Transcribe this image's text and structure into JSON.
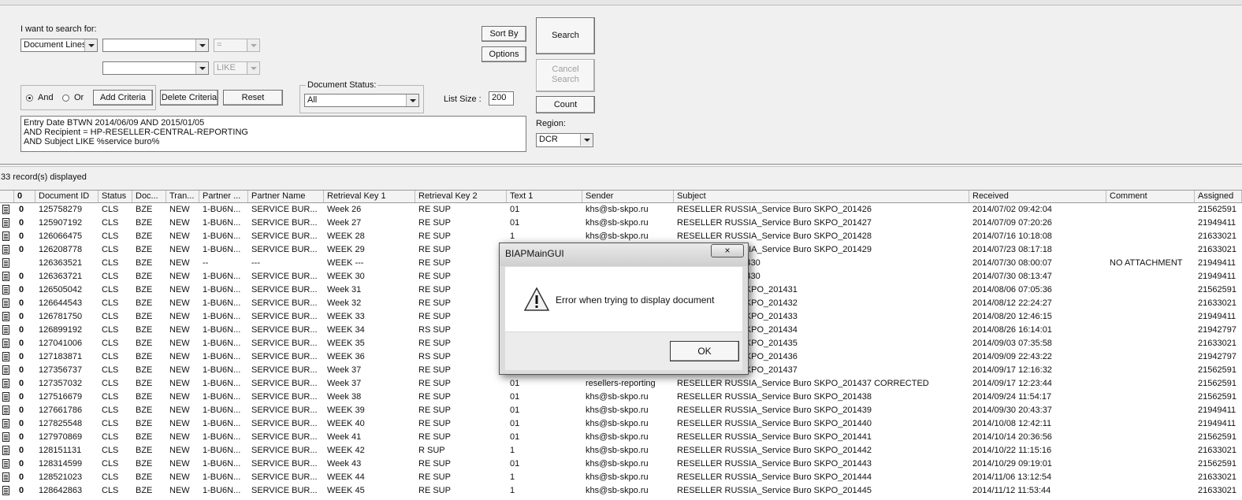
{
  "search": {
    "heading": "I want to search for:",
    "type_value": "Document Lines",
    "row1_field": "",
    "row1_op": "=",
    "row2_field": "",
    "row2_op": "LIKE",
    "and_label": "And",
    "or_label": "Or",
    "add_criteria": "Add Criteria",
    "delete_criteria": "Delete Criteria",
    "reset": "Reset",
    "doc_status_label": "Document Status:",
    "doc_status_value": "All",
    "list_size_label": "List Size :",
    "list_size_value": "200",
    "criteria_text": "Entry Date BTWN 2014/06/09 AND 2015/01/05\nAND Recipient = HP-RESELLER-CENTRAL-REPORTING\nAND Subject LIKE %service buro%",
    "sort_by": "Sort By",
    "options": "Options",
    "search_btn": "Search",
    "cancel_search": "Cancel\nSearch",
    "count": "Count",
    "region_label": "Region:",
    "region_value": "DCR"
  },
  "status": {
    "records": "33 record(s) displayed"
  },
  "grid": {
    "attachment_glyph": "0",
    "columns": [
      "Document ID",
      "Status",
      "Doc...",
      "Tran...",
      "Partner ...",
      "Partner Name",
      "Retrieval Key 1",
      "Retrieval Key 2",
      "Text 1",
      "Sender",
      "Subject",
      "Received",
      "Comment",
      "Assigned"
    ],
    "rows": [
      {
        "att": true,
        "cells": [
          "125758279",
          "CLS",
          "BZE",
          "NEW",
          "1-BU6N...",
          "SERVICE BUR...",
          "Week 26",
          "RE SUP",
          "01",
          "khs@sb-skpo.ru",
          "RESELLER RUSSIA_Service Buro SKPO_201426",
          "2014/07/02 09:42:04",
          "",
          "21562591"
        ]
      },
      {
        "att": true,
        "cells": [
          "125907192",
          "CLS",
          "BZE",
          "NEW",
          "1-BU6N...",
          "SERVICE BUR...",
          "Week 27",
          "RE SUP",
          "01",
          "khs@sb-skpo.ru",
          "RESELLER RUSSIA_Service Buro SKPO_201427",
          "2014/07/09 07:20:26",
          "",
          "21949411"
        ]
      },
      {
        "att": true,
        "cells": [
          "126066475",
          "CLS",
          "BZE",
          "NEW",
          "1-BU6N...",
          "SERVICE BUR...",
          "WEEK 28",
          "RE SUP",
          "1",
          "khs@sb-skpo.ru",
          "RESELLER RUSSIA_Service Buro SKPO_201428",
          "2014/07/16 10:18:08",
          "",
          "21633021"
        ]
      },
      {
        "att": true,
        "cells": [
          "126208778",
          "CLS",
          "BZE",
          "NEW",
          "1-BU6N...",
          "SERVICE BUR...",
          "WEEK 29",
          "RE SUP",
          "",
          "",
          "RESELLER RUSSIA_Service Buro SKPO_201429",
          "2014/07/23 08:17:18",
          "",
          "21633021"
        ]
      },
      {
        "att": false,
        "cells": [
          "126363521",
          "CLS",
          "BZE",
          "NEW",
          "--",
          "---",
          "WEEK ---",
          "RE SUP",
          "",
          "",
          "_SALES_INV 201430",
          "2014/07/30 08:00:07",
          "NO ATTACHMENT",
          "21949411"
        ]
      },
      {
        "att": true,
        "cells": [
          "126363721",
          "CLS",
          "BZE",
          "NEW",
          "1-BU6N...",
          "SERVICE BUR...",
          "WEEK 30",
          "RE SUP",
          "",
          "",
          "_SALES_INV 201430",
          "2014/07/30 08:13:47",
          "",
          "21949411"
        ]
      },
      {
        "att": true,
        "cells": [
          "126505042",
          "CLS",
          "BZE",
          "NEW",
          "1-BU6N...",
          "SERVICE BUR...",
          "Week 31",
          "RE SUP",
          "",
          "",
          "A_Service Buro SKPO_201431",
          "2014/08/06 07:05:36",
          "",
          "21562591"
        ]
      },
      {
        "att": true,
        "cells": [
          "126644543",
          "CLS",
          "BZE",
          "NEW",
          "1-BU6N...",
          "SERVICE BUR...",
          "Week 32",
          "RE SUP",
          "",
          "",
          "A_Service Buro SKPO_201432",
          "2014/08/12 22:24:27",
          "",
          "21633021"
        ]
      },
      {
        "att": true,
        "cells": [
          "126781750",
          "CLS",
          "BZE",
          "NEW",
          "1-BU6N...",
          "SERVICE BUR...",
          "WEEK 33",
          "RE SUP",
          "",
          "",
          "A_Service Buro SKPO_201433",
          "2014/08/20 12:46:15",
          "",
          "21949411"
        ]
      },
      {
        "att": true,
        "cells": [
          "126899192",
          "CLS",
          "BZE",
          "NEW",
          "1-BU6N...",
          "SERVICE BUR...",
          "WEEK 34",
          "RS SUP",
          "",
          "",
          "A_Service Buro SKPO_201434",
          "2014/08/26 16:14:01",
          "",
          "21942797"
        ]
      },
      {
        "att": true,
        "cells": [
          "127041006",
          "CLS",
          "BZE",
          "NEW",
          "1-BU6N...",
          "SERVICE BUR...",
          "WEEK 35",
          "RE SUP",
          "",
          "",
          "A_Service Buro SKPO_201435",
          "2014/09/03 07:35:58",
          "",
          "21633021"
        ]
      },
      {
        "att": true,
        "cells": [
          "127183871",
          "CLS",
          "BZE",
          "NEW",
          "1-BU6N...",
          "SERVICE BUR...",
          "WEEK 36",
          "RS SUP",
          "",
          "",
          "A_Service Buro SKPO_201436",
          "2014/09/09 22:43:22",
          "",
          "21942797"
        ]
      },
      {
        "att": true,
        "cells": [
          "127356737",
          "CLS",
          "BZE",
          "NEW",
          "1-BU6N...",
          "SERVICE BUR...",
          "Week 37",
          "RE SUP",
          "",
          "",
          "A_Service Buro SKPO_201437",
          "2014/09/17 12:16:32",
          "",
          "21562591"
        ]
      },
      {
        "att": true,
        "cells": [
          "127357032",
          "CLS",
          "BZE",
          "NEW",
          "1-BU6N...",
          "SERVICE BUR...",
          "Week 37",
          "RE SUP",
          "01",
          "resellers-reporting",
          "RESELLER RUSSIA_Service Buro SKPO_201437 CORRECTED",
          "2014/09/17 12:23:44",
          "",
          "21562591"
        ]
      },
      {
        "att": true,
        "cells": [
          "127516679",
          "CLS",
          "BZE",
          "NEW",
          "1-BU6N...",
          "SERVICE BUR...",
          "Week 38",
          "RE SUP",
          "01",
          "khs@sb-skpo.ru",
          "RESELLER RUSSIA_Service Buro SKPO_201438",
          "2014/09/24 11:54:17",
          "",
          "21562591"
        ]
      },
      {
        "att": true,
        "cells": [
          "127661786",
          "CLS",
          "BZE",
          "NEW",
          "1-BU6N...",
          "SERVICE BUR...",
          "WEEK 39",
          "RE SUP",
          "01",
          "khs@sb-skpo.ru",
          "RESELLER RUSSIA_Service Buro SKPO_201439",
          "2014/09/30 20:43:37",
          "",
          "21949411"
        ]
      },
      {
        "att": true,
        "cells": [
          "127825548",
          "CLS",
          "BZE",
          "NEW",
          "1-BU6N...",
          "SERVICE BUR...",
          "WEEK 40",
          "RE SUP",
          "01",
          "khs@sb-skpo.ru",
          "RESELLER RUSSIA_Service Buro SKPO_201440",
          "2014/10/08 12:42:11",
          "",
          "21949411"
        ]
      },
      {
        "att": true,
        "cells": [
          "127970869",
          "CLS",
          "BZE",
          "NEW",
          "1-BU6N...",
          "SERVICE BUR...",
          "Week 41",
          "RE SUP",
          "01",
          "khs@sb-skpo.ru",
          "RESELLER RUSSIA_Service Buro SKPO_201441",
          "2014/10/14 20:36:56",
          "",
          "21562591"
        ]
      },
      {
        "att": true,
        "cells": [
          "128151131",
          "CLS",
          "BZE",
          "NEW",
          "1-BU6N...",
          "SERVICE BUR...",
          "WEEK 42",
          "R SUP",
          "1",
          "khs@sb-skpo.ru",
          "RESELLER RUSSIA_Service Buro SKPO_201442",
          "2014/10/22 11:15:16",
          "",
          "21633021"
        ]
      },
      {
        "att": true,
        "cells": [
          "128314599",
          "CLS",
          "BZE",
          "NEW",
          "1-BU6N...",
          "SERVICE BUR...",
          "Week 43",
          "RE SUP",
          "01",
          "khs@sb-skpo.ru",
          "RESELLER RUSSIA_Service Buro SKPO_201443",
          "2014/10/29 09:19:01",
          "",
          "21562591"
        ]
      },
      {
        "att": true,
        "cells": [
          "128521023",
          "CLS",
          "BZE",
          "NEW",
          "1-BU6N...",
          "SERVICE BUR...",
          "WEEK 44",
          "RE SUP",
          "1",
          "khs@sb-skpo.ru",
          "RESELLER RUSSIA_Service Buro SKPO_201444",
          "2014/11/06 13:12:54",
          "",
          "21633021"
        ]
      },
      {
        "att": true,
        "cells": [
          "128642863",
          "CLS",
          "BZE",
          "NEW",
          "1-BU6N...",
          "SERVICE BUR...",
          "WEEK 45",
          "RE SUP",
          "1",
          "khs@sb-skpo.ru",
          "RESELLER RUSSIA_Service Buro SKPO_201445",
          "2014/11/12 11:53:44",
          "",
          "21633021"
        ]
      }
    ]
  },
  "dialog": {
    "title": "BIAPMainGUI",
    "close_glyph": "×",
    "message": "Error when trying to display document",
    "ok": "OK",
    "icon": "warning-icon"
  }
}
